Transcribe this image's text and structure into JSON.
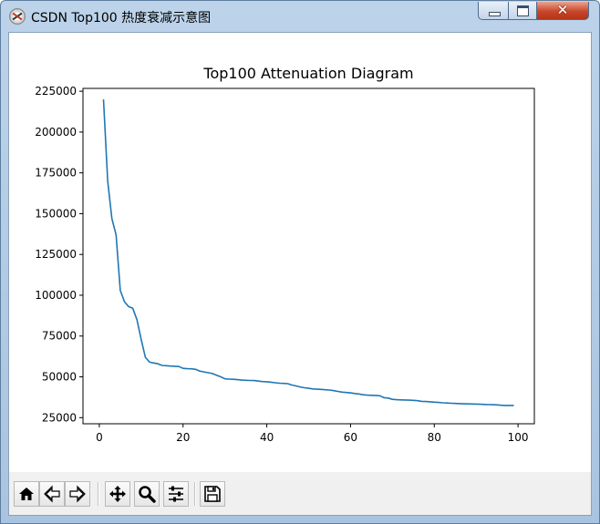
{
  "window": {
    "title": "CSDN Top100 热度衰减示意图",
    "icon": "feather-icon",
    "close_glyph": "✕"
  },
  "colors": {
    "line": "#1f77b4",
    "titlebar": "#bcd3ea",
    "close": "#c9472a",
    "toolbar": "#f0f0f0"
  },
  "toolbar": {
    "buttons": [
      {
        "name": "home-button",
        "icon": "home-icon"
      },
      {
        "name": "back-button",
        "icon": "arrow-left-icon"
      },
      {
        "name": "forward-button",
        "icon": "arrow-right-icon"
      },
      {
        "name": "pan-button",
        "icon": "move-icon"
      },
      {
        "name": "zoom-button",
        "icon": "magnifier-icon"
      },
      {
        "name": "configure-subplots-button",
        "icon": "sliders-icon"
      },
      {
        "name": "save-button",
        "icon": "floppy-disk-icon"
      }
    ]
  },
  "chart_data": {
    "type": "line",
    "title": "Top100 Attenuation Diagram",
    "xlabel": "",
    "ylabel": "",
    "xlim": [
      -3.9,
      103.9
    ],
    "ylim": [
      21250,
      226750
    ],
    "xticks": [
      0,
      20,
      40,
      60,
      80,
      100
    ],
    "yticks": [
      25000,
      50000,
      75000,
      100000,
      125000,
      150000,
      175000,
      200000,
      225000
    ],
    "grid": false,
    "x": [
      1,
      2,
      3,
      4,
      5,
      6,
      7,
      8,
      9,
      10,
      11,
      12,
      13,
      14,
      15,
      16,
      17,
      18,
      19,
      20,
      21,
      22,
      23,
      24,
      25,
      26,
      27,
      28,
      29,
      30,
      31,
      32,
      33,
      34,
      35,
      36,
      37,
      38,
      39,
      40,
      41,
      42,
      43,
      44,
      45,
      46,
      47,
      48,
      49,
      50,
      51,
      52,
      53,
      54,
      55,
      56,
      57,
      58,
      59,
      60,
      61,
      62,
      63,
      64,
      65,
      66,
      67,
      68,
      69,
      70,
      71,
      72,
      73,
      74,
      75,
      76,
      77,
      78,
      79,
      80,
      81,
      82,
      83,
      84,
      85,
      86,
      87,
      88,
      89,
      90,
      91,
      92,
      93,
      94,
      95,
      96,
      97,
      98,
      99
    ],
    "values": [
      220000,
      170000,
      147000,
      137000,
      103000,
      96000,
      93000,
      92000,
      85000,
      73000,
      62000,
      59000,
      58500,
      58000,
      57000,
      56800,
      56600,
      56500,
      56300,
      55200,
      55000,
      54900,
      54600,
      53500,
      53000,
      52500,
      52000,
      51000,
      50000,
      48800,
      48600,
      48500,
      48300,
      48000,
      47900,
      47800,
      47700,
      47400,
      47100,
      47000,
      46700,
      46400,
      46100,
      46000,
      45800,
      45000,
      44400,
      43800,
      43300,
      43000,
      42600,
      42400,
      42300,
      42100,
      41900,
      41500,
      41100,
      40600,
      40400,
      40200,
      39800,
      39500,
      39000,
      38800,
      38700,
      38600,
      38400,
      37200,
      37000,
      36200,
      36000,
      35900,
      35800,
      35700,
      35600,
      35400,
      35000,
      34900,
      34700,
      34500,
      34300,
      34100,
      34000,
      33800,
      33700,
      33600,
      33500,
      33400,
      33350,
      33300,
      33200,
      33100,
      33000,
      32900,
      32800,
      32600,
      32500,
      32500,
      32500
    ]
  }
}
